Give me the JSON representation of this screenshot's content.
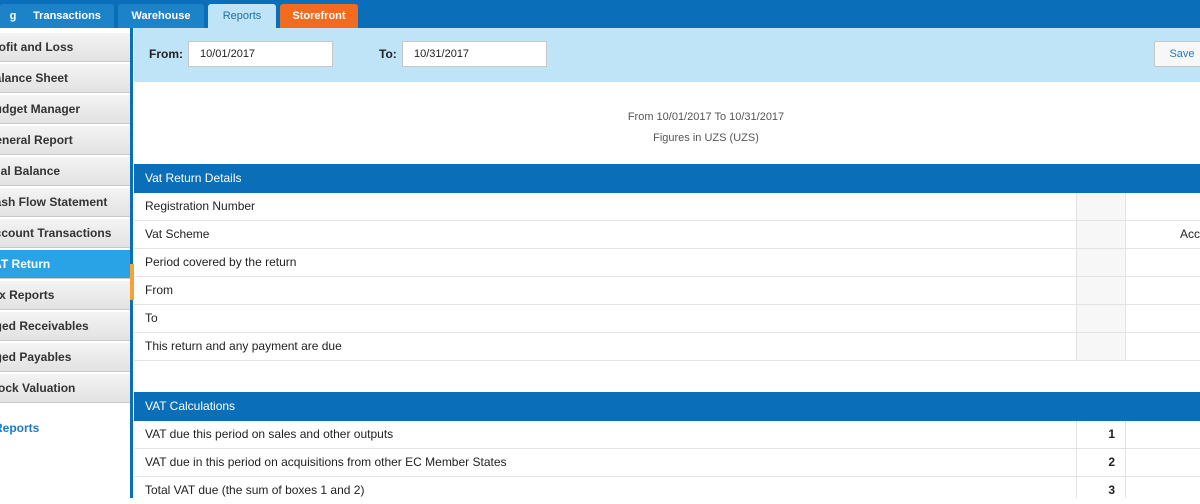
{
  "top_tabs": [
    {
      "label": "g"
    },
    {
      "label": "Transactions"
    },
    {
      "label": "Warehouse"
    },
    {
      "label": "Reports"
    },
    {
      "label": "Storefront"
    }
  ],
  "sidebar": {
    "items": [
      {
        "label": "Profit and Loss"
      },
      {
        "label": "Balance Sheet"
      },
      {
        "label": "Budget Manager"
      },
      {
        "label": "General Report"
      },
      {
        "label": "Trial Balance"
      },
      {
        "label": "Cash Flow Statement"
      },
      {
        "label": "Account Transactions"
      },
      {
        "label": "VAT Return"
      },
      {
        "label": "Tax Reports"
      },
      {
        "label": "Aged Receivables"
      },
      {
        "label": "Aged Payables"
      },
      {
        "label": "Stock Valuation"
      }
    ],
    "link": "Reports"
  },
  "filter": {
    "from_label": "From:",
    "from_value": "10/01/2017",
    "to_label": "To:",
    "to_value": "10/31/2017",
    "save_label": "Save"
  },
  "report": {
    "period_text": "From 10/01/2017 To 10/31/2017",
    "currency_text": "Figures in UZS (UZS)"
  },
  "sections": {
    "details": {
      "title": "Vat Return Details",
      "rows": [
        {
          "label": "Registration Number",
          "box": "",
          "value": ""
        },
        {
          "label": "Vat Scheme",
          "box": "",
          "value": "Acc"
        },
        {
          "label": "Period covered by the return",
          "box": "",
          "value": ""
        },
        {
          "label": "From",
          "box": "",
          "value": ""
        },
        {
          "label": "To",
          "box": "",
          "value": ""
        },
        {
          "label": "This return and any payment are due",
          "box": "",
          "value": ""
        }
      ]
    },
    "calculations": {
      "title": "VAT Calculations",
      "rows": [
        {
          "label": "VAT due this period on sales and other outputs",
          "box": "1",
          "value": ""
        },
        {
          "label": "VAT due in this period on acquisitions from other EC Member States",
          "box": "2",
          "value": ""
        },
        {
          "label": "Total VAT due (the sum of boxes 1 and 2)",
          "box": "3",
          "value": ""
        }
      ]
    }
  },
  "colors": {
    "brand_blue": "#0a6fb8",
    "active_tab": "#bfe3f7",
    "storefront_orange": "#f36a21",
    "active_sidebar": "#29a3e5"
  }
}
